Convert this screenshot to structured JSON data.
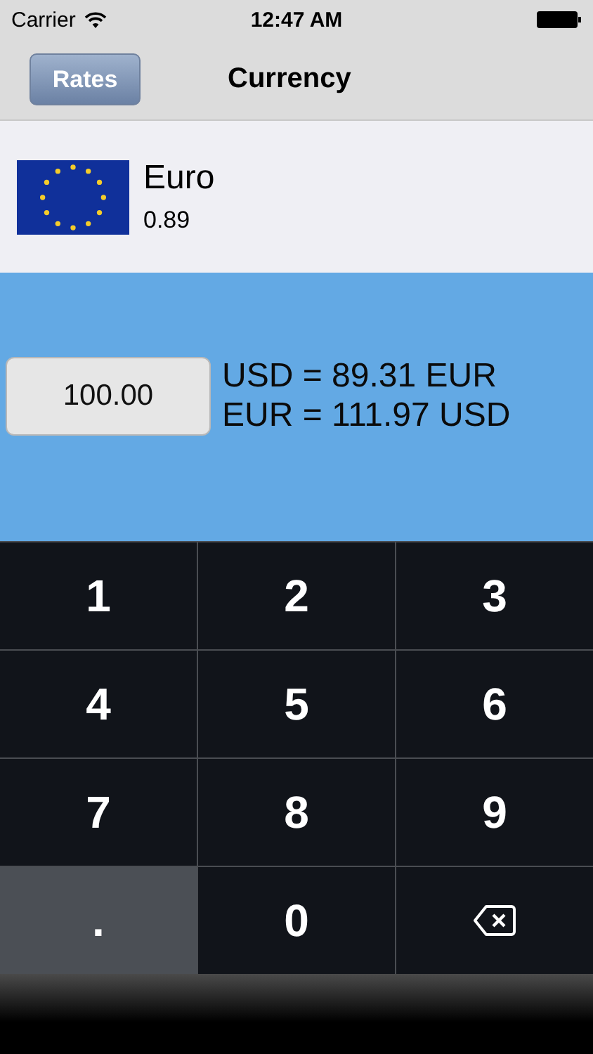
{
  "status_bar": {
    "carrier": "Carrier",
    "time": "12:47 AM"
  },
  "nav_bar": {
    "back_button": "Rates",
    "title": "Currency"
  },
  "currency": {
    "name": "Euro",
    "rate": "0.89"
  },
  "converter": {
    "amount": "100.00",
    "lines": [
      "USD = 89.31 EUR",
      "EUR = 111.97 USD"
    ]
  },
  "keypad": [
    {
      "kind": "digit",
      "label": "1"
    },
    {
      "kind": "digit",
      "label": "2"
    },
    {
      "kind": "digit",
      "label": "3"
    },
    {
      "kind": "digit",
      "label": "4"
    },
    {
      "kind": "digit",
      "label": "5"
    },
    {
      "kind": "digit",
      "label": "6"
    },
    {
      "kind": "digit",
      "label": "7"
    },
    {
      "kind": "digit",
      "label": "8"
    },
    {
      "kind": "digit",
      "label": "9"
    },
    {
      "kind": "symbol",
      "label": "."
    },
    {
      "kind": "digit",
      "label": "0"
    },
    {
      "kind": "backspace"
    }
  ]
}
